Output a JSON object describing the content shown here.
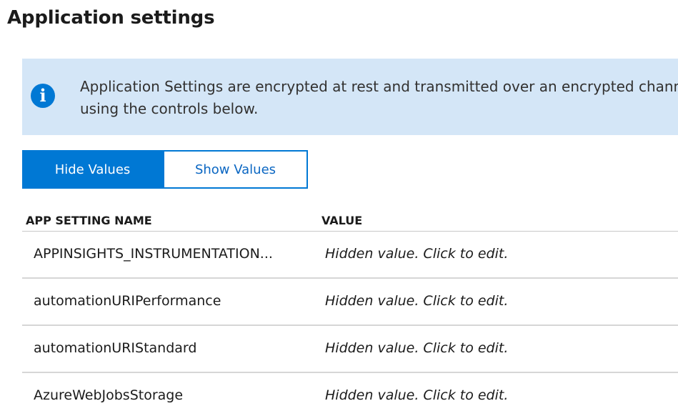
{
  "page": {
    "title": "Application settings"
  },
  "info_banner": {
    "icon": "info-icon",
    "icon_glyph": "i",
    "line1": "Application Settings are encrypted at rest and transmitted over an encrypted channel.",
    "line2": "using the controls below."
  },
  "toggle": {
    "hide_label": "Hide Values",
    "show_label": "Show Values",
    "selected": "Hide Values"
  },
  "table": {
    "columns": {
      "name": "APP SETTING NAME",
      "value": "VALUE"
    },
    "rows": [
      {
        "name": "APPINSIGHTS_INSTRUMENTATION...",
        "value": "Hidden value. Click to edit."
      },
      {
        "name": "automationURIPerformance",
        "value": "Hidden value. Click to edit."
      },
      {
        "name": "automationURIStandard",
        "value": "Hidden value. Click to edit."
      },
      {
        "name": "AzureWebJobsStorage",
        "value": "Hidden value. Click to edit."
      }
    ]
  },
  "colors": {
    "accent": "#0078d4",
    "banner_bg": "#d4e6f7",
    "link": "#0a66c2"
  }
}
